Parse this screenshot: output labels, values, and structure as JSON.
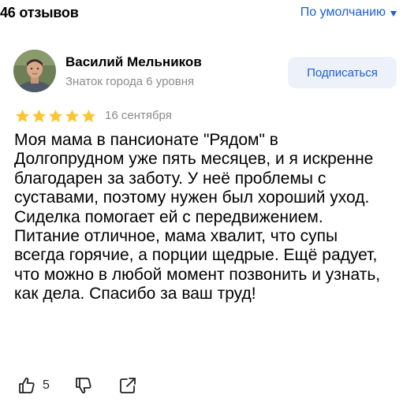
{
  "header": {
    "reviews_count": "46 отзывов",
    "sort_label": "По умолчанию"
  },
  "review": {
    "author_name": "Василий Мельников",
    "author_level": "Знаток города 6 уровня",
    "subscribe_label": "Подписаться",
    "rating": 5,
    "date": "16 сентября",
    "text": "Моя мама в пансионате \"Рядом\" в Долгопрудном уже пять месяцев, и я искренне благодарен за заботу. У неё проблемы с суставами, поэтому нужен был хороший уход. Сиделка помогает ей с передвижением. Питание отличное, мама хвалит, что супы всегда горячие, а порции щедрые. Ещё радует, что можно в любой момент позвонить и узнать, как дела. Спасибо за ваш труд!",
    "likes": "5"
  },
  "icons": {
    "sort": "chevron-down-icon",
    "stars": "star-icon",
    "like": "thumbs-up-icon",
    "dislike": "thumbs-down-icon",
    "share": "share-icon"
  },
  "colors": {
    "accent": "#1a5fd8",
    "star": "#fec42b",
    "secondary_text": "#8b8b8b",
    "button_bg": "#edf2fa"
  }
}
